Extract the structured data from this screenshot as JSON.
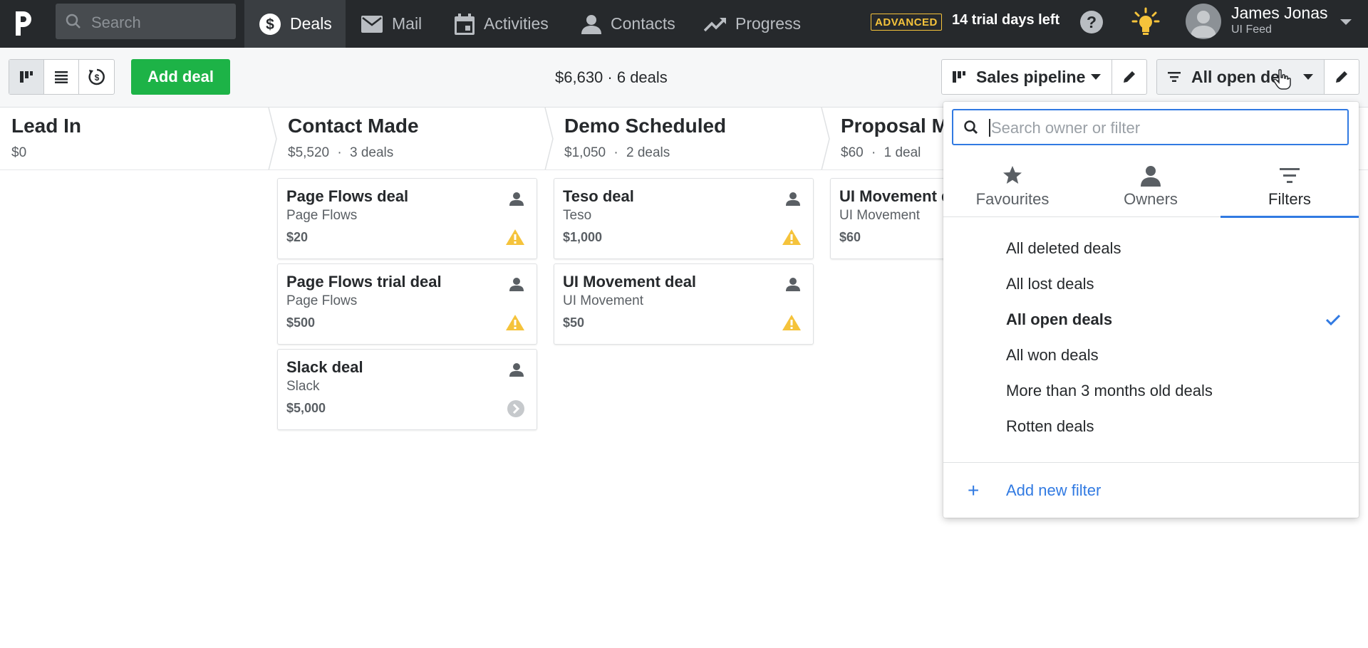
{
  "nav": {
    "search_placeholder": "Search",
    "items": [
      {
        "label": "Deals",
        "icon": "dollar-icon",
        "active": true
      },
      {
        "label": "Mail",
        "icon": "mail-icon"
      },
      {
        "label": "Activities",
        "icon": "calendar-icon"
      },
      {
        "label": "Contacts",
        "icon": "person-icon"
      },
      {
        "label": "Progress",
        "icon": "trend-icon"
      }
    ],
    "plan_badge": "ADVANCED",
    "trial_text": "14 trial days left",
    "user_name": "James Jonas",
    "user_company": "UI Feed"
  },
  "toolbar": {
    "add_deal_label": "Add deal",
    "summary": "$6,630 · 6 deals",
    "pipeline_label": "Sales pipeline",
    "filter_label": "All open de"
  },
  "stages": [
    {
      "title": "Lead In",
      "value": "$0",
      "count": ""
    },
    {
      "title": "Contact Made",
      "value": "$5,520",
      "count": "3 deals"
    },
    {
      "title": "Demo Scheduled",
      "value": "$1,050",
      "count": "2 deals"
    },
    {
      "title": "Proposal Ma",
      "value": "$60",
      "count": "1 deal"
    }
  ],
  "deals": {
    "contact_made": [
      {
        "title": "Page Flows deal",
        "org": "Page Flows",
        "value": "$20",
        "status": "warning"
      },
      {
        "title": "Page Flows trial deal",
        "org": "Page Flows",
        "value": "$500",
        "status": "warning"
      },
      {
        "title": "Slack deal",
        "org": "Slack",
        "value": "$5,000",
        "status": "next"
      }
    ],
    "demo_scheduled": [
      {
        "title": "Teso deal",
        "org": "Teso",
        "value": "$1,000",
        "status": "warning"
      },
      {
        "title": "UI Movement deal",
        "org": "UI Movement",
        "value": "$50",
        "status": "warning"
      }
    ],
    "proposal_made": [
      {
        "title": "UI Movement d",
        "org": "UI Movement",
        "value": "$60",
        "status": ""
      }
    ]
  },
  "dropdown": {
    "search_placeholder": "Search owner or filter",
    "tabs": [
      {
        "label": "Favourites",
        "icon": "star-icon"
      },
      {
        "label": "Owners",
        "icon": "person-icon"
      },
      {
        "label": "Filters",
        "icon": "filter-icon",
        "active": true
      }
    ],
    "filters": [
      {
        "label": "All deleted deals"
      },
      {
        "label": "All lost deals"
      },
      {
        "label": "All open deals",
        "selected": true
      },
      {
        "label": "All won deals"
      },
      {
        "label": "More than 3 months old deals"
      },
      {
        "label": "Rotten deals"
      }
    ],
    "add_filter_label": "Add new filter"
  },
  "colors": {
    "nav_bg": "#26292c",
    "add_deal_green": "#1db347",
    "accent_blue": "#317ae2",
    "warning_yellow": "#f5c33b"
  }
}
